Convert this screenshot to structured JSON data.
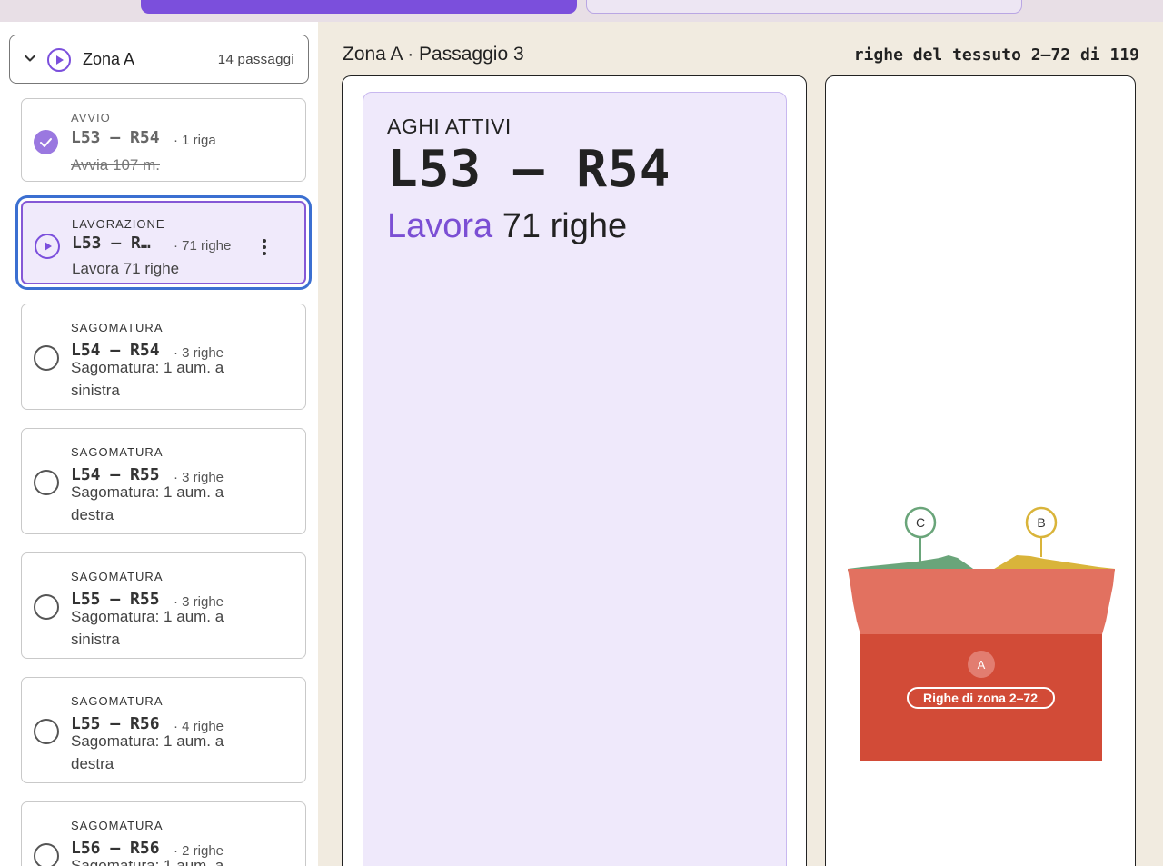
{
  "colors": {
    "accent": "#7b4fdc",
    "active_card_bg": "#f0eafb",
    "focus_ring": "#3b6fd1",
    "background": "#f1ebe0",
    "zone_a": "#d24b37",
    "zone_a_upper": "#e27160",
    "zone_b": "#d9b43a",
    "zone_c": "#6aa57a"
  },
  "sidebar": {
    "zone": {
      "name": "Zona A",
      "count": "14 passaggi",
      "icon": "play-circle-icon"
    },
    "steps": [
      {
        "kind": "AVVIO",
        "needles": "L53 — R54",
        "rows": "· 1 riga",
        "desc": "Avvia 107 m.",
        "status": "done"
      },
      {
        "kind": "LAVORAZIONE",
        "needles": "L53 — R…",
        "rows": "· 71 righe",
        "desc": "Lavora 71 righe",
        "status": "active"
      },
      {
        "kind": "SAGOMATURA",
        "needles": "L54 — R54",
        "rows": "· 3 righe",
        "desc": "Sagomatura: 1 aum. a sinistra",
        "status": "pending"
      },
      {
        "kind": "SAGOMATURA",
        "needles": "L54 — R55",
        "rows": "· 3 righe",
        "desc": "Sagomatura: 1 aum. a destra",
        "status": "pending"
      },
      {
        "kind": "SAGOMATURA",
        "needles": "L55 — R55",
        "rows": "· 3 righe",
        "desc": "Sagomatura: 1 aum. a sinistra",
        "status": "pending"
      },
      {
        "kind": "SAGOMATURA",
        "needles": "L55 — R56",
        "rows": "· 4 righe",
        "desc": "Sagomatura: 1 aum. a destra",
        "status": "pending"
      },
      {
        "kind": "SAGOMATURA",
        "needles": "L56 — R56",
        "rows": "· 2 righe",
        "desc": "Sagomatura: 1 aum. a",
        "status": "pending"
      }
    ]
  },
  "main": {
    "title": "Zona A · Passaggio 3",
    "row_info": "righe del tessuto 2–72 di 119",
    "active": {
      "label": "AGHI ATTIVI",
      "needles": "L53 — R54",
      "work_verb": "Lavora",
      "work_rows": "71 righe"
    }
  },
  "diagram": {
    "markers": [
      {
        "letter": "C",
        "color": "#6aa57a"
      },
      {
        "letter": "B",
        "color": "#d9b43a"
      },
      {
        "letter": "A",
        "color": "#d24b37"
      }
    ],
    "zone_label": "Righe di zona 2–72"
  }
}
